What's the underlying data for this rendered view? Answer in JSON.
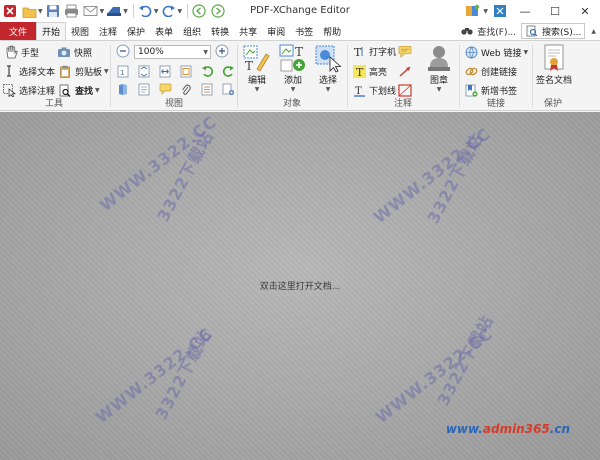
{
  "window": {
    "title": "PDF-XChange Editor",
    "minimize": "—",
    "maximize": "☐",
    "close": "✕"
  },
  "tabs": {
    "file": "文件",
    "items": [
      "开始",
      "视图",
      "注释",
      "保护",
      "表单",
      "组织",
      "转换",
      "共享",
      "审阅",
      "书签",
      "帮助"
    ],
    "active": "开始",
    "find": "查找(F)...",
    "search": "搜索(S)..."
  },
  "ribbon": {
    "tools": {
      "label": "工具",
      "hand": "手型",
      "snapshot": "快照",
      "select_text": "选择文本",
      "clipboard": "剪贴板",
      "select_annot": "选择注释",
      "find": "查找"
    },
    "view": {
      "label": "视图",
      "zoom": "100%"
    },
    "objects": {
      "label": "对象",
      "edit": "编辑",
      "add": "添加",
      "select": "选择"
    },
    "comment": {
      "label": "注释",
      "typewriter": "打字机",
      "highlight": "高亮",
      "underline": "下划线",
      "stamp": "图章"
    },
    "links": {
      "label": "链接",
      "web_links": "Web 链接",
      "create_link": "创建链接",
      "new_bookmark": "新增书签"
    },
    "protect": {
      "label": "保护",
      "sign_document": "签名文档"
    }
  },
  "workarea": {
    "hint": "双击这里打开文档..."
  },
  "watermarks": {
    "diag": "WWW.3322.CC",
    "brand": "3322下载站",
    "site_prefix": "www.",
    "site_mid": "admin365",
    "site_suffix": ".cn"
  },
  "colors": {
    "file_tab": "#c1272d",
    "accent_blue": "#2a66b8"
  }
}
